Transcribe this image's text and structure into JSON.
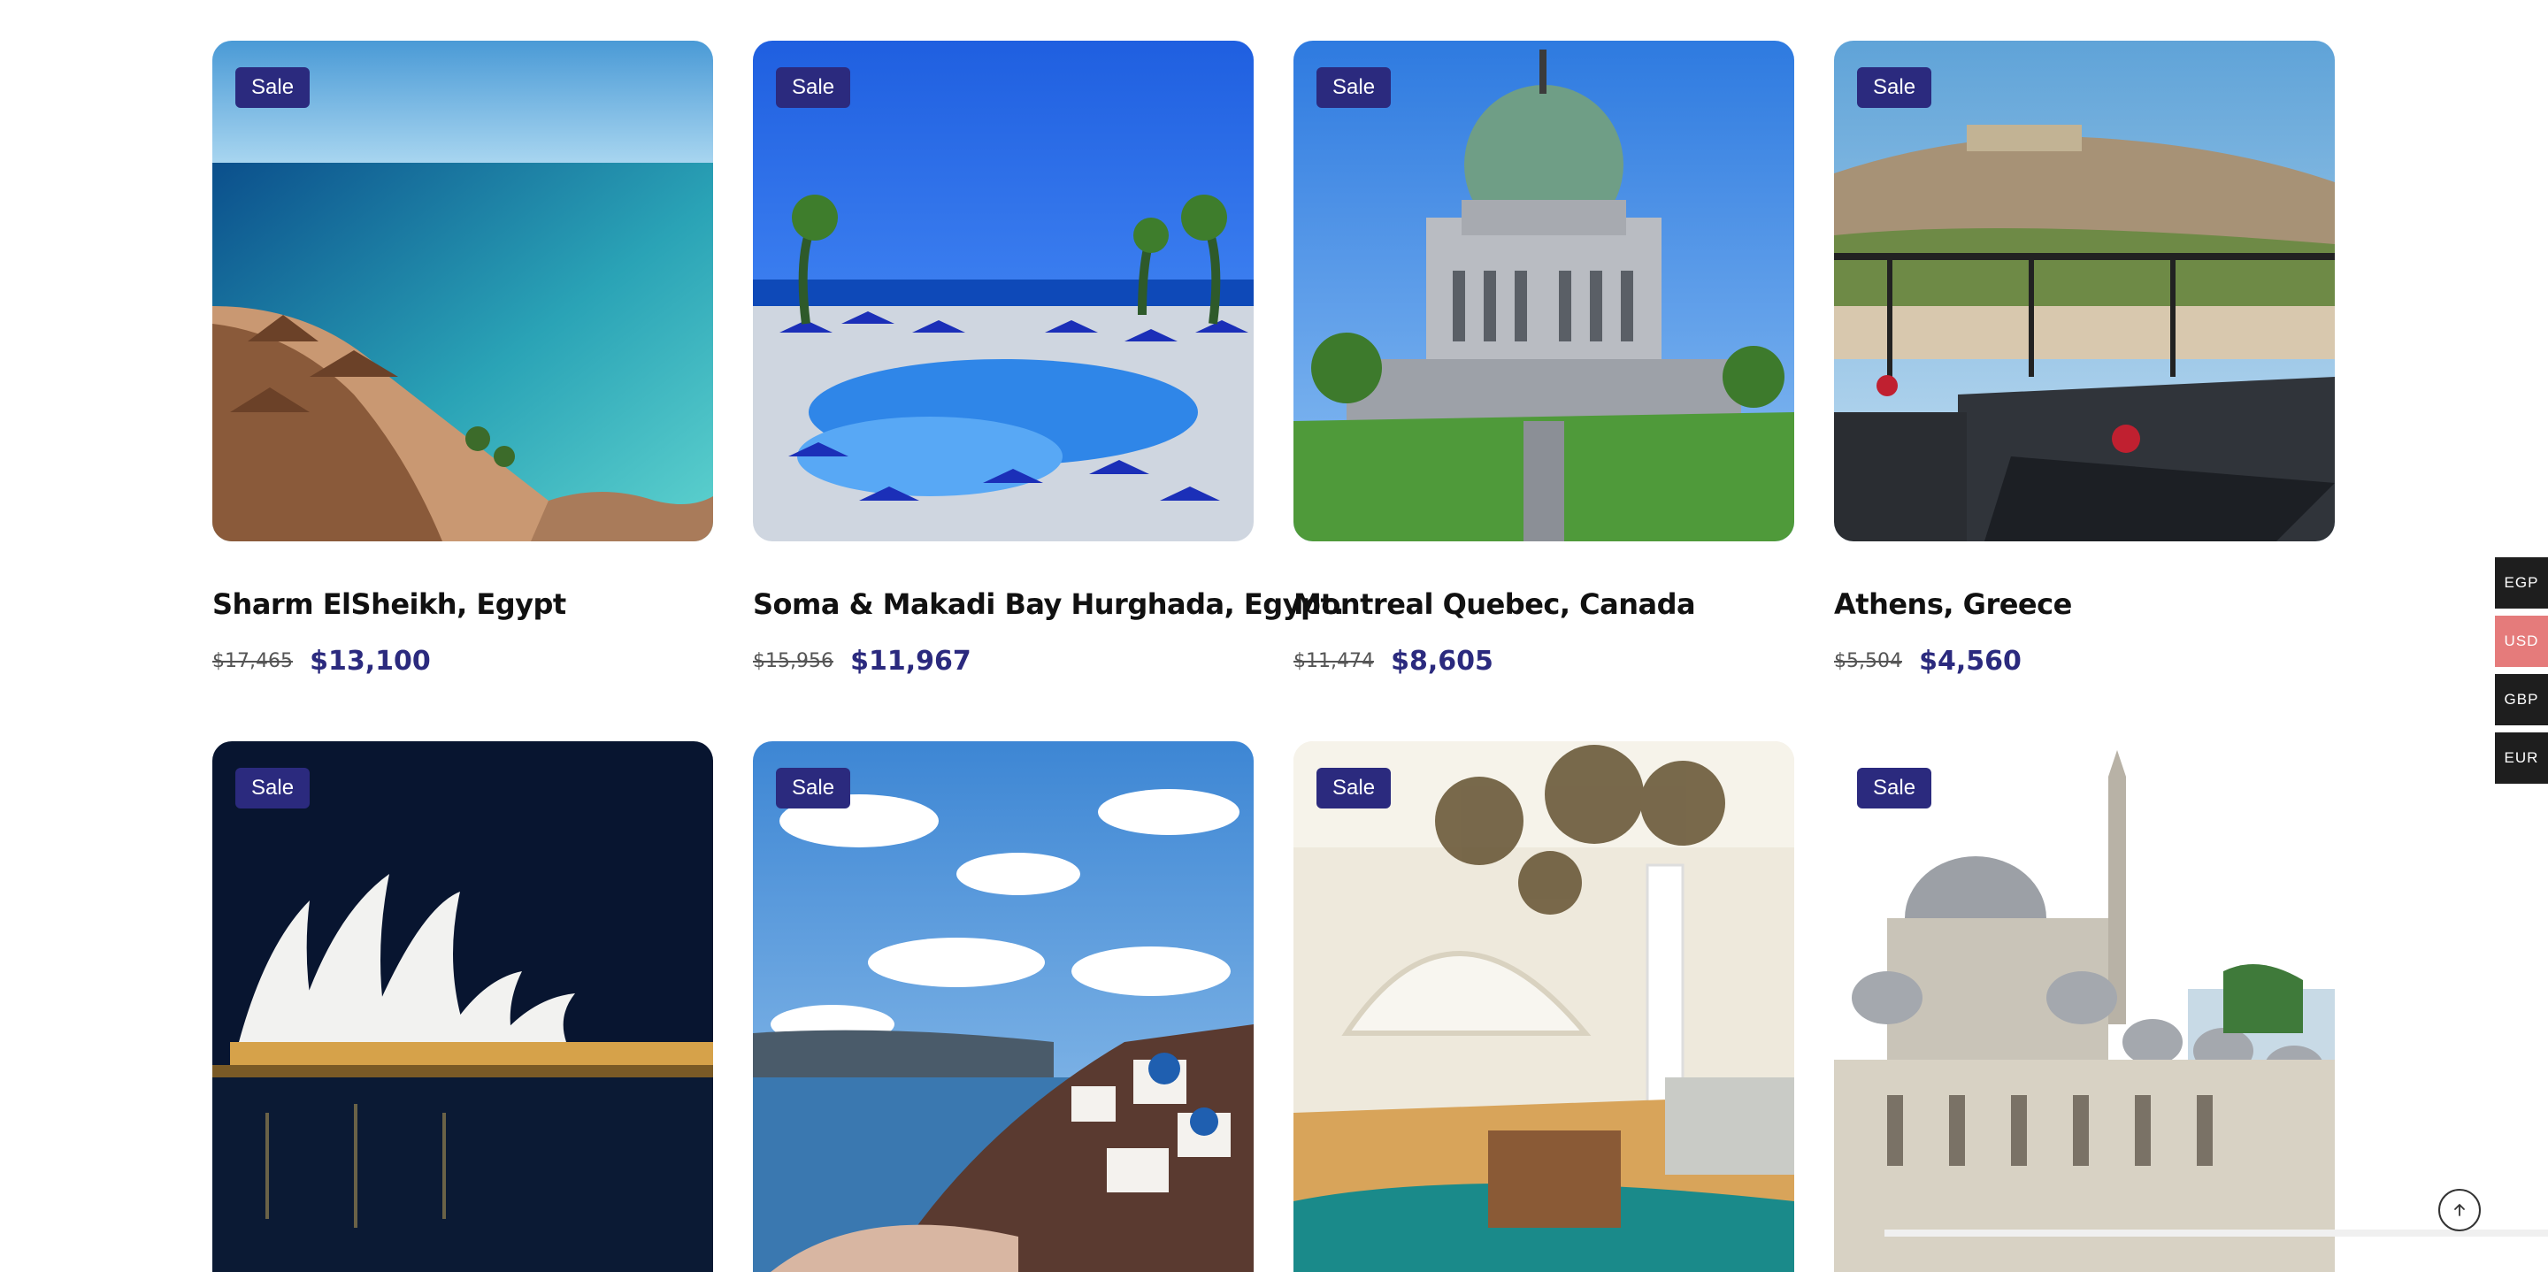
{
  "sale_label": "Sale",
  "destinations": [
    {
      "title": "Sharm ElSheikh, Egypt",
      "old_price": "$17,465",
      "new_price": "$13,100",
      "image": "beach-resort-photo"
    },
    {
      "title": "Soma & Makadi Bay Hurghada, Egypt.",
      "old_price": "$15,956",
      "new_price": "$11,967",
      "image": "pool-resort-photo"
    },
    {
      "title": "Montreal Quebec, Canada",
      "old_price": "$11,474",
      "new_price": "$8,605",
      "image": "oratory-photo"
    },
    {
      "title": "Athens, Greece",
      "old_price": "$5,504",
      "new_price": "$4,560",
      "image": "acropolis-terrace-photo"
    },
    {
      "title": "",
      "old_price": "",
      "new_price": "",
      "image": "sydney-opera-photo"
    },
    {
      "title": "",
      "old_price": "",
      "new_price": "",
      "image": "santorini-photo"
    },
    {
      "title": "",
      "old_price": "",
      "new_price": "",
      "image": "hotel-lobby-photo"
    },
    {
      "title": "",
      "old_price": "",
      "new_price": "",
      "image": "mosque-photo"
    }
  ],
  "currencies": [
    {
      "code": "EGP",
      "active": false
    },
    {
      "code": "USD",
      "active": true
    },
    {
      "code": "GBP",
      "active": false
    },
    {
      "code": "EUR",
      "active": false
    }
  ],
  "colors": {
    "accent": "#2b2a7e",
    "currency_active": "#e57b7b",
    "currency_bg": "#1e1e1e"
  },
  "scroll_top_icon": "arrow-up-icon"
}
